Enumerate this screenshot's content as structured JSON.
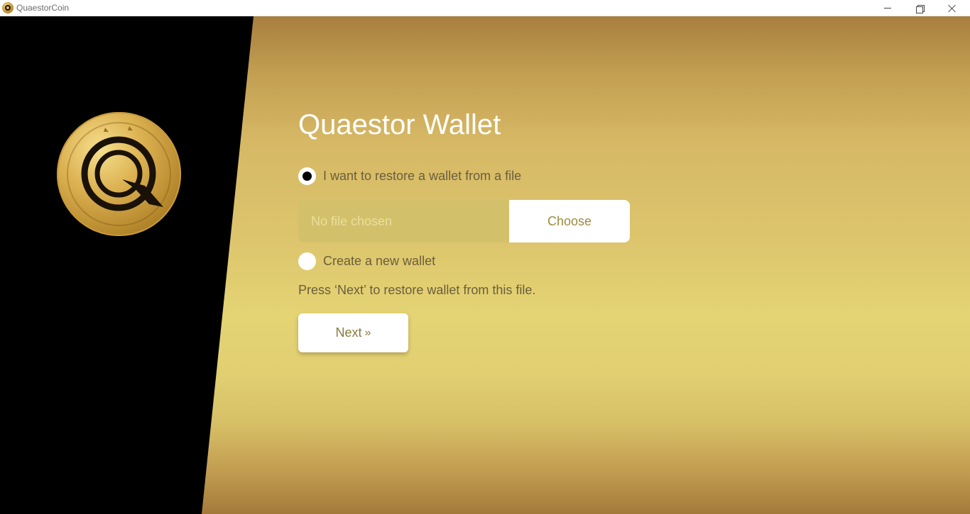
{
  "window": {
    "title": "QuaestorCoin",
    "icons": {
      "app": "quaestor-coin-icon",
      "minimize": "minimize-icon",
      "restore": "restore-icon",
      "close": "close-icon"
    }
  },
  "brand": {
    "logo": "quaestor-coin-logo",
    "colors": {
      "panel": "#000000",
      "gold_light": "#e4d474",
      "gold_dark": "#a87f3f",
      "text": "#6b5e3c"
    }
  },
  "wallet": {
    "title": "Quaestor Wallet",
    "options": [
      {
        "label": "I want to restore a wallet from a file",
        "selected": true
      },
      {
        "label": "Create a new wallet",
        "selected": false
      }
    ],
    "file": {
      "placeholder": "No file chosen",
      "choose_label": "Choose"
    },
    "hint": "Press ‘Next’ to restore wallet from this file.",
    "next_label": "Next",
    "next_icon": "double-chevron-right-icon"
  }
}
